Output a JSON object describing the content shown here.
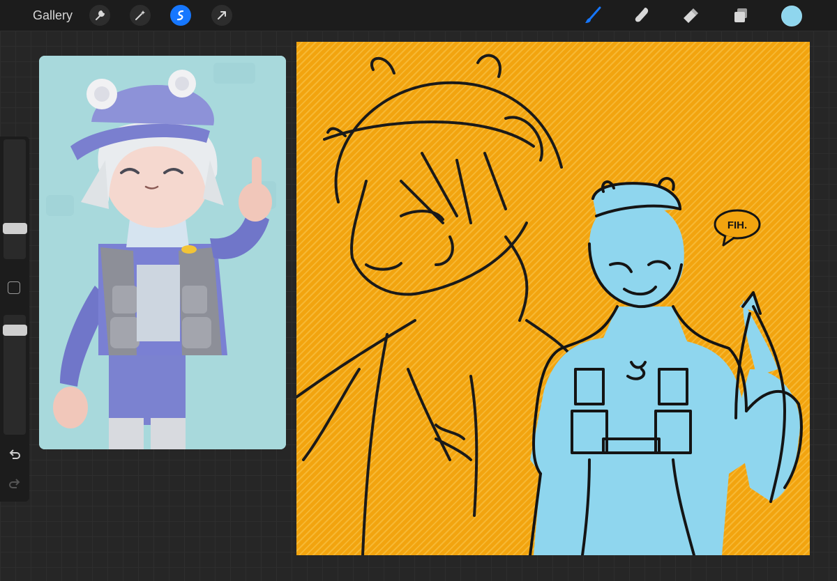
{
  "toolbar": {
    "gallery_label": "Gallery",
    "left_tools": [
      "wrench-icon",
      "magic-wand-icon",
      "selection-icon",
      "transform-arrow-icon"
    ],
    "active_tool": "selection-icon",
    "right_tools": [
      "brush-icon",
      "smudge-icon",
      "eraser-icon",
      "layers-icon"
    ],
    "current_color": "#8fd6ee",
    "brush_color": "#1677ff"
  },
  "sidebar": {
    "brush_size_level": 0.74,
    "opacity_level": 0.07,
    "buttons": [
      "modify-button",
      "undo-icon",
      "redo-icon"
    ]
  },
  "canvas": {
    "speech_bubble_text": "FIH.",
    "background_color": "#f2a40f",
    "figure_fill_color": "#8fd6ee"
  }
}
